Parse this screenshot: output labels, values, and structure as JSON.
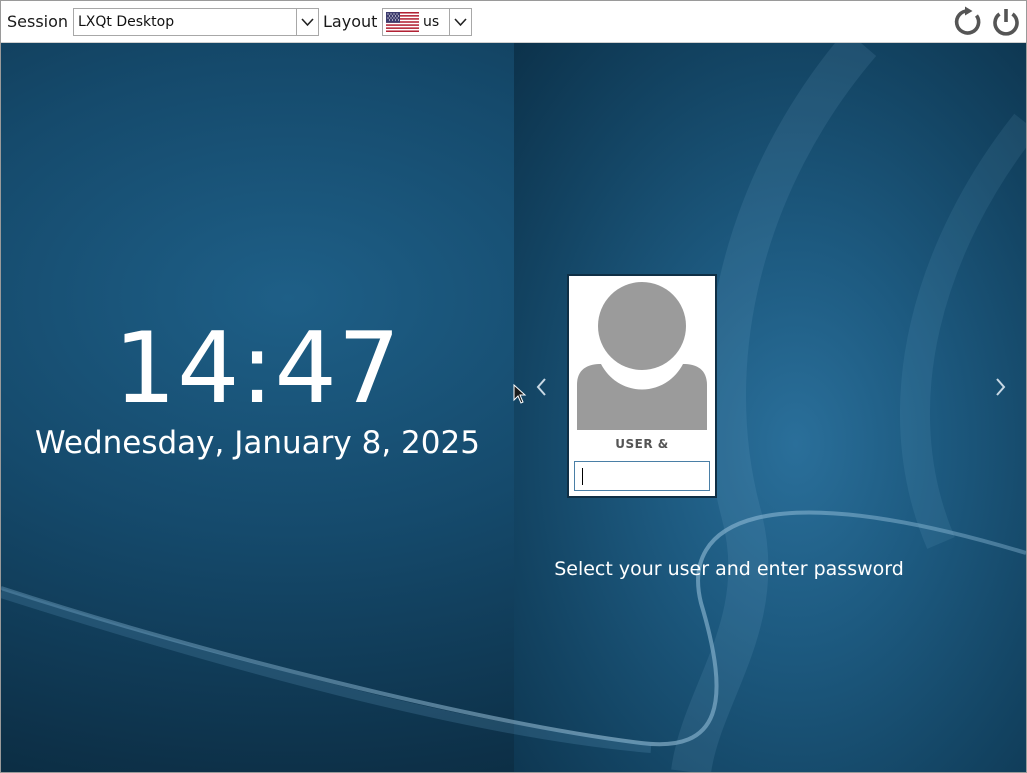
{
  "topbar": {
    "session_label": "Session",
    "session_value": "LXQt Desktop",
    "layout_label": "Layout",
    "layout_value": "us",
    "layout_flag_icon": "us-flag-icon",
    "restart_icon": "restart-icon",
    "shutdown_icon": "power-icon"
  },
  "clock": {
    "time": "14:47",
    "date": "Wednesday, January 8, 2025"
  },
  "login": {
    "user_name": "USER &",
    "password_value": "",
    "hint": "Select your user and enter password",
    "prev_icon": "chevron-left-icon",
    "next_icon": "chevron-right-icon",
    "avatar_icon": "user-avatar-icon"
  },
  "colors": {
    "background_dark": "#0d3149",
    "background_light": "#2a6f9a",
    "card_border": "#0f2f45",
    "avatar_gray": "#9b9b9b",
    "input_border": "#4a7fa6"
  }
}
